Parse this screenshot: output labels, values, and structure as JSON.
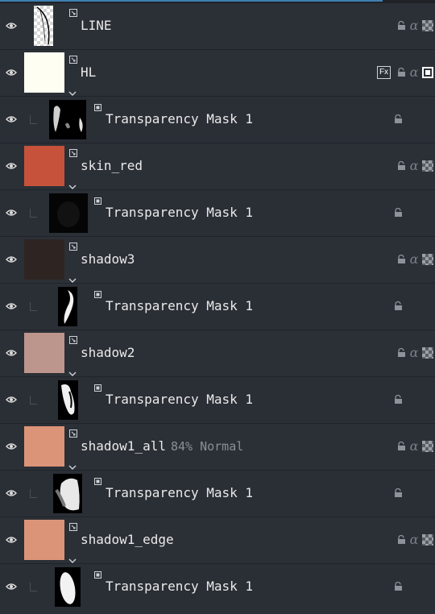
{
  "colors": {
    "panel_bg": "#2b2f36",
    "row_border": "#20242a",
    "text": "#eaeaea",
    "dim_text": "#8a8f96",
    "accent": "#3f7fb3"
  },
  "layers": [
    {
      "name": "LINE",
      "kind": "paint",
      "thumb_color": "#ffffff",
      "locked": true,
      "alpha": "α",
      "inherit_alpha": true,
      "fx": false
    },
    {
      "name": "HL",
      "kind": "paint",
      "thumb_color": "#fffef2",
      "locked": true,
      "alpha": "α",
      "inherit_alpha": true,
      "fx": true,
      "fx_label": "Fx"
    },
    {
      "name": "Transparency Mask 1",
      "kind": "mask"
    },
    {
      "name": "skin_red",
      "kind": "paint",
      "thumb_color": "#c7523c",
      "locked": true,
      "alpha": "α",
      "inherit_alpha": true
    },
    {
      "name": "Transparency Mask 1",
      "kind": "mask"
    },
    {
      "name": "shadow3",
      "kind": "paint",
      "thumb_color": "#2e2523",
      "locked": true,
      "alpha": "α",
      "inherit_alpha": true
    },
    {
      "name": "Transparency Mask 1",
      "kind": "mask"
    },
    {
      "name": "shadow2",
      "kind": "paint",
      "thumb_color": "#bc958d",
      "locked": true,
      "alpha": "α",
      "inherit_alpha": true
    },
    {
      "name": "Transparency Mask 1",
      "kind": "mask"
    },
    {
      "name": "shadow1_all",
      "kind": "paint",
      "thumb_color": "#dc9478",
      "extra": "84% Normal",
      "locked": true,
      "alpha": "α",
      "inherit_alpha": true
    },
    {
      "name": "Transparency Mask 1",
      "kind": "mask"
    },
    {
      "name": "shadow1_edge",
      "kind": "paint",
      "thumb_color": "#dc9478",
      "locked": true,
      "alpha": "α",
      "inherit_alpha": true
    },
    {
      "name": "Transparency Mask 1",
      "kind": "mask"
    }
  ],
  "icons": {
    "visibility": "eye-icon",
    "lock": "lock-icon",
    "alpha": "alpha-lock-icon",
    "inherit": "inherit-alpha-icon",
    "expand": "chevron-down-icon",
    "layer_type": "paint-layer-icon",
    "mask_type": "mask-layer-icon"
  }
}
